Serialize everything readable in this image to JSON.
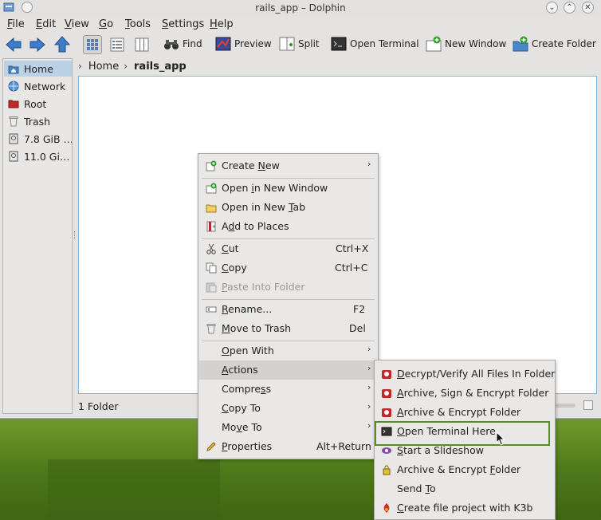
{
  "window": {
    "title": "rails_app – Dolphin"
  },
  "menubar": {
    "items": [
      {
        "pre": "",
        "u": "F",
        "post": "ile"
      },
      {
        "pre": "",
        "u": "E",
        "post": "dit"
      },
      {
        "pre": "",
        "u": "V",
        "post": "iew"
      },
      {
        "pre": "",
        "u": "G",
        "post": "o"
      },
      {
        "pre": "",
        "u": "T",
        "post": "ools"
      },
      {
        "pre": "",
        "u": "S",
        "post": "ettings"
      },
      {
        "pre": "",
        "u": "H",
        "post": "elp"
      }
    ]
  },
  "toolbar": {
    "find": "Find",
    "preview": "Preview",
    "split": "Split",
    "open_terminal": "Open Terminal",
    "new_window": "New Window",
    "create_folder": "Create Folder"
  },
  "places": {
    "items": [
      {
        "label": "Home"
      },
      {
        "label": "Network"
      },
      {
        "label": "Root"
      },
      {
        "label": "Trash"
      },
      {
        "label": "7.8 GiB …"
      },
      {
        "label": "11.0 Gi…"
      }
    ]
  },
  "breadcrumb": {
    "items": [
      "Home",
      "rails_app"
    ]
  },
  "status": {
    "text": "1 Folder"
  },
  "context_menu": {
    "create_new": {
      "pre": "Create ",
      "u": "N",
      "post": "ew"
    },
    "open_new_window": {
      "pre": "Open ",
      "u": "i",
      "post": "n New Window"
    },
    "open_new_tab": {
      "pre": "Open in New ",
      "u": "T",
      "post": "ab"
    },
    "add_to_places": {
      "pre": "A",
      "u": "d",
      "post": "d to Places"
    },
    "cut": {
      "pre": "",
      "u": "C",
      "post": "ut",
      "shortcut": "Ctrl+X"
    },
    "copy": {
      "pre": "",
      "u": "C",
      "post": "opy",
      "shortcut": "Ctrl+C"
    },
    "paste": {
      "pre": "",
      "u": "P",
      "post": "aste Into Folder"
    },
    "rename": {
      "pre": "",
      "u": "R",
      "post": "ename...",
      "shortcut": "F2"
    },
    "trash": {
      "pre": "",
      "u": "M",
      "post": "ove to Trash",
      "shortcut": "Del"
    },
    "open_with": {
      "pre": "",
      "u": "O",
      "post": "pen With"
    },
    "actions": {
      "pre": "",
      "u": "A",
      "post": "ctions"
    },
    "compress": {
      "pre": "Compre",
      "u": "s",
      "post": "s"
    },
    "copy_to": {
      "pre": "",
      "u": "C",
      "post": "opy To"
    },
    "move_to": {
      "pre": "Mo",
      "u": "v",
      "post": "e To"
    },
    "properties": {
      "pre": "",
      "u": "P",
      "post": "roperties",
      "shortcut": "Alt+Return"
    }
  },
  "submenu": {
    "decrypt": {
      "pre": "",
      "u": "D",
      "post": "ecrypt/Verify All Files In Folder"
    },
    "archive_sign": {
      "pre": "",
      "u": "A",
      "post": "rchive, Sign & Encrypt Folder"
    },
    "archive_encrypt": {
      "pre": "",
      "u": "A",
      "post": "rchive & Encrypt Folder"
    },
    "open_terminal_here": {
      "pre": "",
      "u": "O",
      "post": "pen Terminal Here"
    },
    "slideshow": {
      "pre": "",
      "u": "S",
      "post": "tart a Slideshow"
    },
    "archive_encrypt2": {
      "pre": "Archive & Encrypt ",
      "u": "F",
      "post": "older"
    },
    "send_to": {
      "pre": "Send ",
      "u": "T",
      "post": "o"
    },
    "k3b": {
      "pre": "",
      "u": "C",
      "post": "reate file project with K3b"
    }
  },
  "colors": {
    "accent": "#86b1d8",
    "selection": "#bcd0e6",
    "highlight_frame": "#5a8a2a"
  }
}
